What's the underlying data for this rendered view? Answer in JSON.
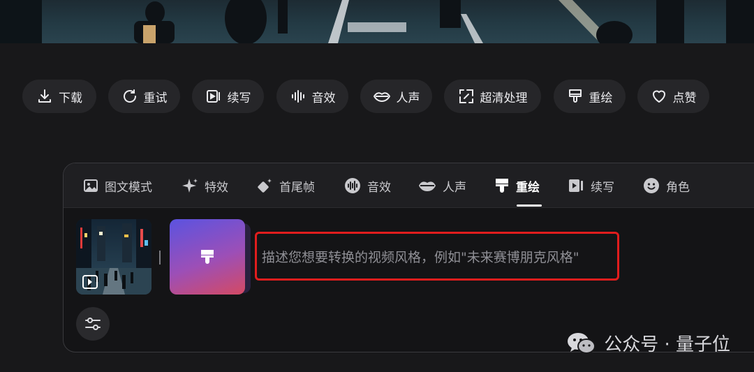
{
  "actions": [
    {
      "label": "下载",
      "icon": "download-icon"
    },
    {
      "label": "重试",
      "icon": "retry-icon"
    },
    {
      "label": "续写",
      "icon": "continue-icon"
    },
    {
      "label": "音效",
      "icon": "sound-effect-icon"
    },
    {
      "label": "人声",
      "icon": "lips-icon"
    },
    {
      "label": "超清处理",
      "icon": "hd-enhance-icon"
    },
    {
      "label": "重绘",
      "icon": "brush-icon"
    },
    {
      "label": "点赞",
      "icon": "heart-icon"
    }
  ],
  "panel": {
    "tabs": [
      {
        "label": "图文模式",
        "icon": "image-icon"
      },
      {
        "label": "特效",
        "icon": "sparkle-icon"
      },
      {
        "label": "首尾帧",
        "icon": "keyframes-icon"
      },
      {
        "label": "音效",
        "icon": "sound-effect-icon"
      },
      {
        "label": "人声",
        "icon": "lips-icon"
      },
      {
        "label": "重绘",
        "icon": "brush-icon",
        "active": true
      },
      {
        "label": "续写",
        "icon": "continue-icon"
      },
      {
        "label": "角色",
        "icon": "smiley-icon"
      }
    ],
    "prompt_placeholder": "描述您想要转换的视频风格，例如\"未来赛博朋克风格\""
  },
  "watermark": {
    "text": "公众号 · 量子位"
  },
  "colors": {
    "highlight_border": "#e11d1d",
    "style_gradient_start": "#5b53e0",
    "style_gradient_end": "#d44a63"
  }
}
